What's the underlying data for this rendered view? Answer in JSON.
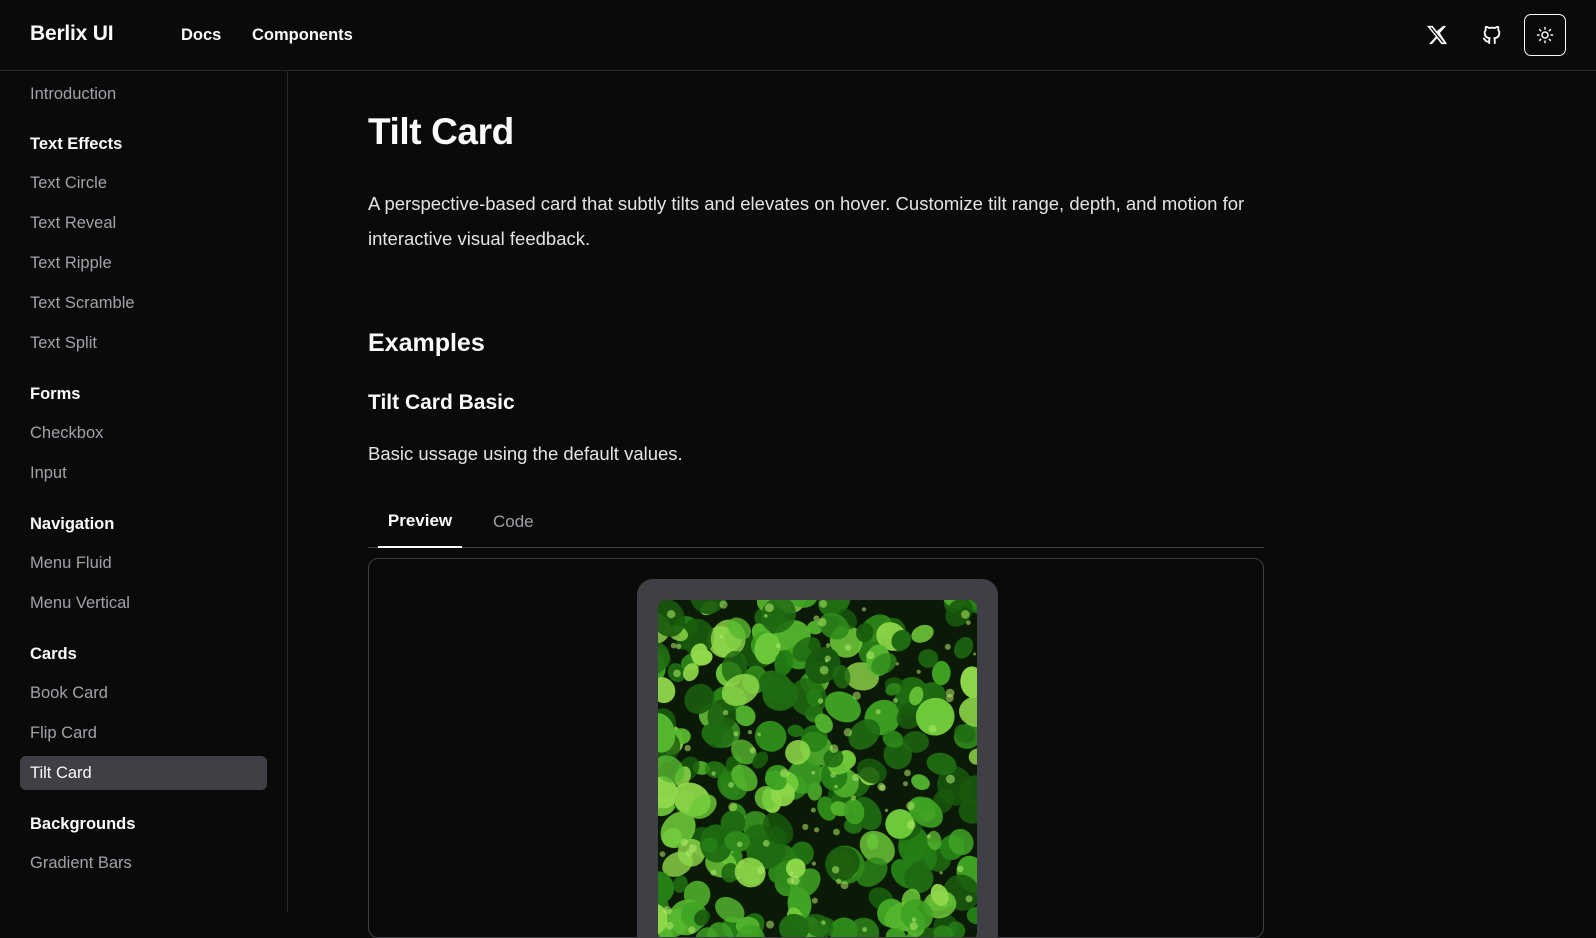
{
  "header": {
    "brand": "Berlix UI",
    "nav": [
      "Docs",
      "Components"
    ],
    "icons": [
      "x-logo-icon",
      "github-icon",
      "sun-icon"
    ]
  },
  "sidebar": {
    "intro": "Introduction",
    "groups": [
      {
        "title": "Text Effects",
        "items": [
          "Text Circle",
          "Text Reveal",
          "Text Ripple",
          "Text Scramble",
          "Text Split"
        ]
      },
      {
        "title": "Forms",
        "items": [
          "Checkbox",
          "Input"
        ]
      },
      {
        "title": "Navigation",
        "items": [
          "Menu Fluid",
          "Menu Vertical"
        ]
      },
      {
        "title": "Cards",
        "items": [
          "Book Card",
          "Flip Card",
          "Tilt Card"
        ]
      },
      {
        "title": "Backgrounds",
        "items": [
          "Gradient Bars"
        ]
      }
    ],
    "active": "Tilt Card"
  },
  "main": {
    "title": "Tilt Card",
    "description": "A perspective-based card that subtly tilts and elevates on hover. Customize tilt range, depth, and motion for interactive visual feedback.",
    "examples_heading": "Examples",
    "example_title": "Tilt Card Basic",
    "example_desc": "Basic ussage using the default values.",
    "tabs": [
      "Preview",
      "Code"
    ],
    "active_tab": "Preview"
  },
  "colors": {
    "background": "#0a0a0a",
    "border": "#27272a",
    "active_item": "#3f3f46",
    "card_frame": "#3f3f46",
    "leaf": "#3fa324"
  }
}
